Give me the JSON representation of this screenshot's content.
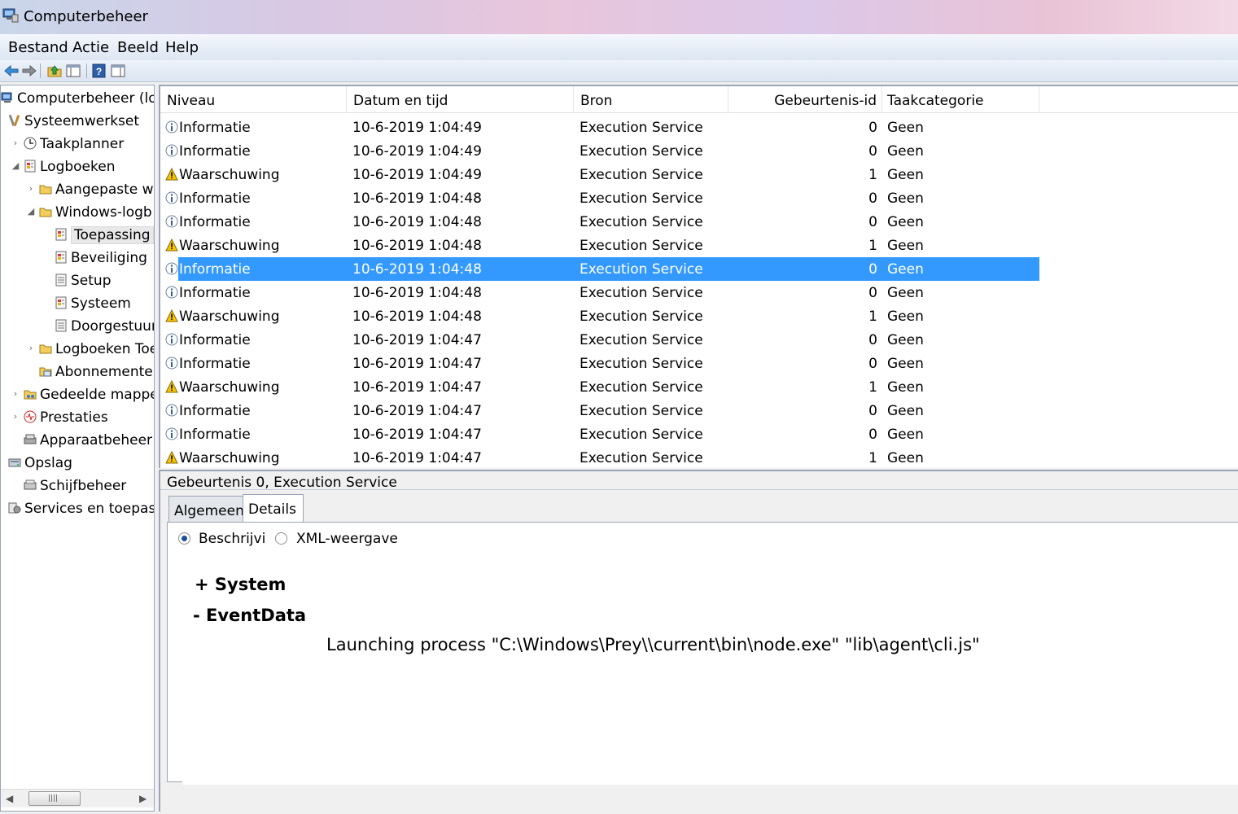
{
  "window": {
    "title": "Computerbeheer"
  },
  "menu": [
    "Bestand",
    "Actie",
    "Beeld",
    "Help"
  ],
  "toolbar": {
    "icons": [
      "back-arrow-icon",
      "forward-arrow-icon",
      "up-folder-icon",
      "show-hide-tree-icon",
      "help-icon",
      "show-hide-actions-icon"
    ]
  },
  "tree": [
    {
      "label": "Computerbeheer (loka",
      "icon": "computer-icon",
      "indent": 0,
      "expander": "",
      "selected": false
    },
    {
      "label": "Systeemwerkset",
      "icon": "tools-icon",
      "indent": 1,
      "expander": "",
      "selected": false
    },
    {
      "label": "Taakplanner",
      "icon": "clock-icon",
      "indent": 2,
      "expander": "›",
      "selected": false
    },
    {
      "label": "Logboeken",
      "icon": "log-icon",
      "indent": 2,
      "expander": "◢",
      "selected": false
    },
    {
      "label": "Aangepaste we",
      "icon": "folder-icon",
      "indent": 3,
      "expander": "›",
      "selected": false
    },
    {
      "label": "Windows-logb",
      "icon": "folder-icon",
      "indent": 3,
      "expander": "◢",
      "selected": false
    },
    {
      "label": "Toepassing",
      "icon": "log-icon",
      "indent": 4,
      "expander": "",
      "selected": true
    },
    {
      "label": "Beveiliging",
      "icon": "log-icon",
      "indent": 4,
      "expander": "",
      "selected": false
    },
    {
      "label": "Setup",
      "icon": "log-plain-icon",
      "indent": 4,
      "expander": "",
      "selected": false
    },
    {
      "label": "Systeem",
      "icon": "log-icon",
      "indent": 4,
      "expander": "",
      "selected": false
    },
    {
      "label": "Doorgestuur",
      "icon": "log-plain-icon",
      "indent": 4,
      "expander": "",
      "selected": false
    },
    {
      "label": "Logboeken Toe",
      "icon": "folder-icon",
      "indent": 3,
      "expander": "›",
      "selected": false
    },
    {
      "label": "Abonnementer",
      "icon": "subscription-icon",
      "indent": 3,
      "expander": "",
      "selected": false
    },
    {
      "label": "Gedeelde mapper",
      "icon": "shared-folder-icon",
      "indent": 2,
      "expander": "›",
      "selected": false
    },
    {
      "label": "Prestaties",
      "icon": "performance-icon",
      "indent": 2,
      "expander": "›",
      "selected": false
    },
    {
      "label": "Apparaatbeheer",
      "icon": "device-manager-icon",
      "indent": 2,
      "expander": "",
      "selected": false
    },
    {
      "label": "Opslag",
      "icon": "storage-icon",
      "indent": 1,
      "expander": "",
      "selected": false
    },
    {
      "label": "Schijfbeheer",
      "icon": "disk-icon",
      "indent": 2,
      "expander": "",
      "selected": false
    },
    {
      "label": "Services en toepassi",
      "icon": "services-icon",
      "indent": 1,
      "expander": "",
      "selected": false
    }
  ],
  "columns": [
    "Niveau",
    "Datum en tijd",
    "Bron",
    "Gebeurtenis-id",
    "Taakcategorie"
  ],
  "events": [
    {
      "level": "Informatie",
      "type": "info",
      "datetime": "10-6-2019 1:04:49",
      "source": "Execution Service",
      "id": "0",
      "category": "Geen",
      "selected": false
    },
    {
      "level": "Informatie",
      "type": "info",
      "datetime": "10-6-2019 1:04:49",
      "source": "Execution Service",
      "id": "0",
      "category": "Geen",
      "selected": false
    },
    {
      "level": "Waarschuwing",
      "type": "warning",
      "datetime": "10-6-2019 1:04:49",
      "source": "Execution Service",
      "id": "1",
      "category": "Geen",
      "selected": false
    },
    {
      "level": "Informatie",
      "type": "info",
      "datetime": "10-6-2019 1:04:48",
      "source": "Execution Service",
      "id": "0",
      "category": "Geen",
      "selected": false
    },
    {
      "level": "Informatie",
      "type": "info",
      "datetime": "10-6-2019 1:04:48",
      "source": "Execution Service",
      "id": "0",
      "category": "Geen",
      "selected": false
    },
    {
      "level": "Waarschuwing",
      "type": "warning",
      "datetime": "10-6-2019 1:04:48",
      "source": "Execution Service",
      "id": "1",
      "category": "Geen",
      "selected": false
    },
    {
      "level": "Informatie",
      "type": "info",
      "datetime": "10-6-2019 1:04:48",
      "source": "Execution Service",
      "id": "0",
      "category": "Geen",
      "selected": true
    },
    {
      "level": "Informatie",
      "type": "info",
      "datetime": "10-6-2019 1:04:48",
      "source": "Execution Service",
      "id": "0",
      "category": "Geen",
      "selected": false
    },
    {
      "level": "Waarschuwing",
      "type": "warning",
      "datetime": "10-6-2019 1:04:48",
      "source": "Execution Service",
      "id": "1",
      "category": "Geen",
      "selected": false
    },
    {
      "level": "Informatie",
      "type": "info",
      "datetime": "10-6-2019 1:04:47",
      "source": "Execution Service",
      "id": "0",
      "category": "Geen",
      "selected": false
    },
    {
      "level": "Informatie",
      "type": "info",
      "datetime": "10-6-2019 1:04:47",
      "source": "Execution Service",
      "id": "0",
      "category": "Geen",
      "selected": false
    },
    {
      "level": "Waarschuwing",
      "type": "warning",
      "datetime": "10-6-2019 1:04:47",
      "source": "Execution Service",
      "id": "1",
      "category": "Geen",
      "selected": false
    },
    {
      "level": "Informatie",
      "type": "info",
      "datetime": "10-6-2019 1:04:47",
      "source": "Execution Service",
      "id": "0",
      "category": "Geen",
      "selected": false
    },
    {
      "level": "Informatie",
      "type": "info",
      "datetime": "10-6-2019 1:04:47",
      "source": "Execution Service",
      "id": "0",
      "category": "Geen",
      "selected": false
    },
    {
      "level": "Waarschuwing",
      "type": "warning",
      "datetime": "10-6-2019 1:04:47",
      "source": "Execution Service",
      "id": "1",
      "category": "Geen",
      "selected": false
    }
  ],
  "detail": {
    "title": "Gebeurtenis 0, Execution Service",
    "tabs": [
      {
        "label": "Algemeen",
        "active": false
      },
      {
        "label": "Details",
        "active": true
      }
    ],
    "radio_friendly": "Beschrijvi",
    "radio_xml": "XML-weergave",
    "system_label": "+ System",
    "eventdata_label": "-  EventData",
    "eventdata_text": "Launching process \"C:\\Windows\\Prey\\\\current\\bin\\node.exe\" \"lib\\agent\\cli.js\""
  },
  "colors": {
    "selection": "#3399ff",
    "border": "#9aa5b5"
  }
}
